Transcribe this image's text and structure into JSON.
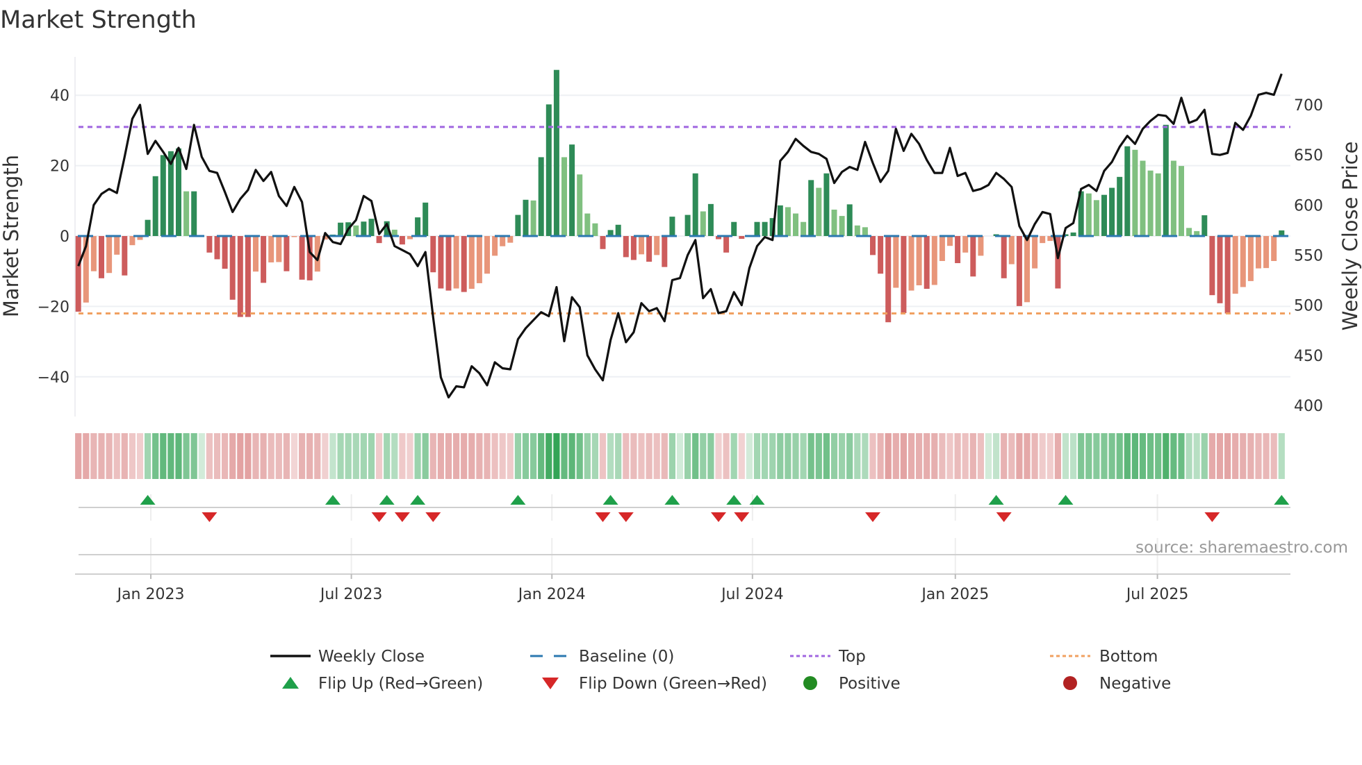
{
  "chart_data": {
    "type": "bar",
    "title": "Market Strength",
    "ylabel": "Market Strength",
    "y2label": "Weekly Close Price",
    "ylim": [
      -51,
      51
    ],
    "y2lim": [
      392,
      758
    ],
    "yticks": [
      "40",
      "20",
      "0",
      "−20",
      "−40"
    ],
    "ytick_values": [
      40,
      20,
      0,
      -20,
      -40
    ],
    "y2ticks": [
      "700",
      "650",
      "600",
      "550",
      "500",
      "450",
      "400"
    ],
    "y2tick_values": [
      700,
      650,
      600,
      550,
      500,
      450,
      400
    ],
    "xticks": [
      "Jan 2023",
      "Jul 2023",
      "Jan 2024",
      "Jul 2024",
      "Jan 2025",
      "Jul 2025"
    ],
    "xtick_week_index": [
      9.4,
      35.4,
      61.4,
      87.4,
      113.7,
      139.9
    ],
    "top_threshold": 31,
    "bottom_threshold": -22,
    "baseline": 0,
    "grid": true,
    "source": "source: sharemaestro.com",
    "strength": [
      -21.5,
      -18.9,
      -10,
      -12,
      -10.5,
      -5.3,
      -11.2,
      -2.6,
      -1.1,
      4.6,
      17,
      23,
      24.1,
      24.9,
      12.7,
      12.7,
      0,
      -4.7,
      -6.6,
      -9.3,
      -18.1,
      -23,
      -23,
      -10.1,
      -13.3,
      -7.5,
      -7.4,
      -10,
      -0.3,
      -12.4,
      -12.6,
      -10.1,
      -1,
      0.4,
      3.8,
      3.9,
      3,
      4.1,
      4.9,
      -2,
      4.2,
      1.8,
      -2.4,
      -0.9,
      5.3,
      9.5,
      -10.3,
      -14.9,
      -15.5,
      -14.9,
      -15.9,
      -15,
      -13.4,
      -10.7,
      -5.6,
      -2.9,
      -1.9,
      6,
      10.3,
      10.1,
      22.4,
      37.4,
      47.2,
      22.4,
      26,
      17.5,
      6.4,
      3.6,
      -3.7,
      1.7,
      3.2,
      -6,
      -6.8,
      -5.2,
      -7.3,
      -5.4,
      -8.8,
      5.5,
      0,
      6,
      17.8,
      7,
      9.1,
      -0.9,
      -4.7,
      4,
      -0.8,
      0,
      4,
      4,
      5.1,
      8.7,
      8.2,
      6.4,
      4,
      15.9,
      13.7,
      17.8,
      7.5,
      5.7,
      9,
      3,
      2.5,
      -5.4,
      -10.7,
      -24.5,
      -14.7,
      -21.9,
      -15.5,
      -14,
      -15,
      -13.9,
      -7.1,
      -2.8,
      -7.7,
      -4.7,
      -11.5,
      -5.6,
      0,
      0.5,
      -12,
      -8,
      -19.9,
      -18.8,
      -9.2,
      -2,
      -1.4,
      -14.9,
      0.5,
      1,
      12.7,
      12.1,
      10.2,
      11.7,
      13.7,
      16.8,
      25.5,
      24.5,
      21.4,
      18.6,
      17.8,
      31.6,
      21.4,
      19.9,
      2.3,
      1.4,
      5.9,
      -16.8,
      -19.1,
      -22,
      -16.4,
      -14.5,
      -12.8,
      -9.2,
      -9.1,
      -7.1,
      1.6
    ],
    "weekly_close": [
      539,
      559,
      600,
      611,
      616,
      612,
      648,
      686,
      700,
      651,
      664,
      653,
      641,
      657,
      636,
      680,
      648,
      634,
      632,
      613,
      593,
      606,
      615,
      635,
      624,
      633,
      609,
      599,
      618,
      603,
      553,
      545,
      572,
      563,
      561,
      576,
      585,
      609,
      604,
      571,
      581,
      559,
      555,
      551,
      539,
      553,
      488,
      428,
      408,
      419,
      418,
      439,
      432,
      420,
      443,
      437,
      436,
      466,
      477,
      485,
      493,
      489,
      518,
      464,
      508,
      498,
      450,
      436,
      425,
      465,
      492,
      463,
      473,
      502,
      494,
      497,
      484,
      525,
      527,
      550,
      565,
      507,
      516,
      492,
      494,
      513,
      500,
      537,
      559,
      568,
      565,
      644,
      653,
      666,
      659,
      653,
      651,
      646,
      622,
      633,
      638,
      635,
      663,
      642,
      623,
      634,
      676,
      654,
      671,
      661,
      645,
      632,
      632,
      657,
      629,
      632,
      614,
      616,
      620,
      632,
      626,
      618,
      579,
      565,
      581,
      593,
      591,
      547,
      577,
      582,
      616,
      620,
      614,
      634,
      643,
      658,
      669,
      661,
      676,
      684,
      690,
      689,
      681,
      707,
      682,
      685,
      695,
      651,
      650,
      652,
      682,
      675,
      689,
      710,
      712,
      710,
      731
    ],
    "legend": [
      {
        "label": "Weekly Close",
        "symbol": "line"
      },
      {
        "label": "Baseline (0)",
        "symbol": "dashed"
      },
      {
        "label": "Top",
        "symbol": "dotted-top"
      },
      {
        "label": "Bottom",
        "symbol": "dotted-bottom"
      },
      {
        "label": "Flip Up (Red→Green)",
        "symbol": "triangle-up"
      },
      {
        "label": "Flip Down (Green→Red)",
        "symbol": "triangle-down"
      },
      {
        "label": "Positive",
        "symbol": "circle-green"
      },
      {
        "label": "Negative",
        "symbol": "circle-red"
      }
    ],
    "colors": {
      "pos_strong": "#2e8b57",
      "pos_weak": "#80c080",
      "neg_strong": "#cd5c5c",
      "neg_weak": "#e8967a",
      "line": "#111111",
      "baseline": "#2b78b0",
      "top": "#a066e0",
      "bottom": "#f0a060",
      "flip_up": "#1fa04a",
      "flip_down": "#d62728",
      "positive": "#228b22",
      "negative": "#b22222"
    }
  }
}
